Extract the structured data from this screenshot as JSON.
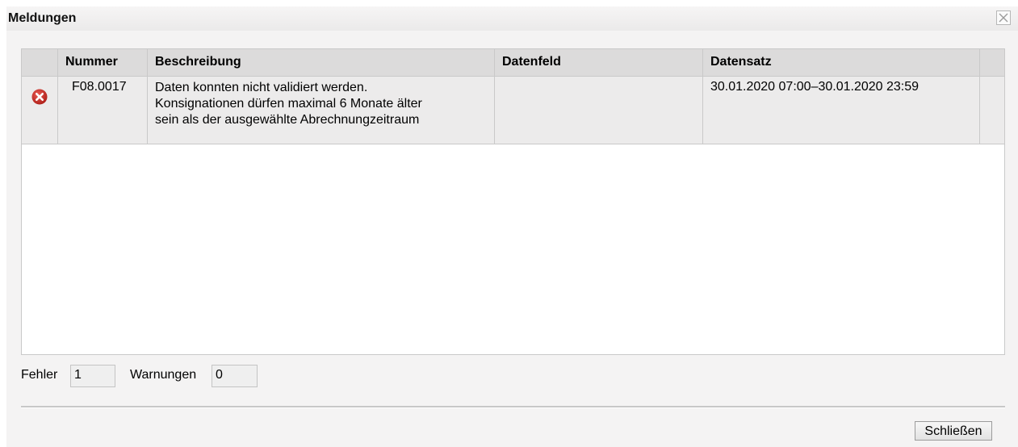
{
  "window": {
    "title": "Meldungen",
    "close_icon": "close-x-icon"
  },
  "table": {
    "columns": [
      "",
      "Nummer",
      "Beschreibung",
      "Datenfeld",
      "Datensatz",
      ""
    ],
    "rows": [
      {
        "status_icon": "error-circle-icon",
        "status_color": "#c0302a",
        "nummer": "F08.0017",
        "beschreibung": [
          "Daten konnten nicht validiert werden.",
          "Konsignationen dürfen maximal 6 Monate älter",
          "sein als der ausgewählte Abrechnungzeitraum"
        ],
        "datenfeld": "",
        "datensatz": "30.01.2020 07:00–30.01.2020 23:59"
      }
    ]
  },
  "counters": {
    "errors_label": "Fehler",
    "errors_value": "1",
    "warnings_label": "Warnungen",
    "warnings_value": "0"
  },
  "footer": {
    "close_label": "Schließen"
  }
}
